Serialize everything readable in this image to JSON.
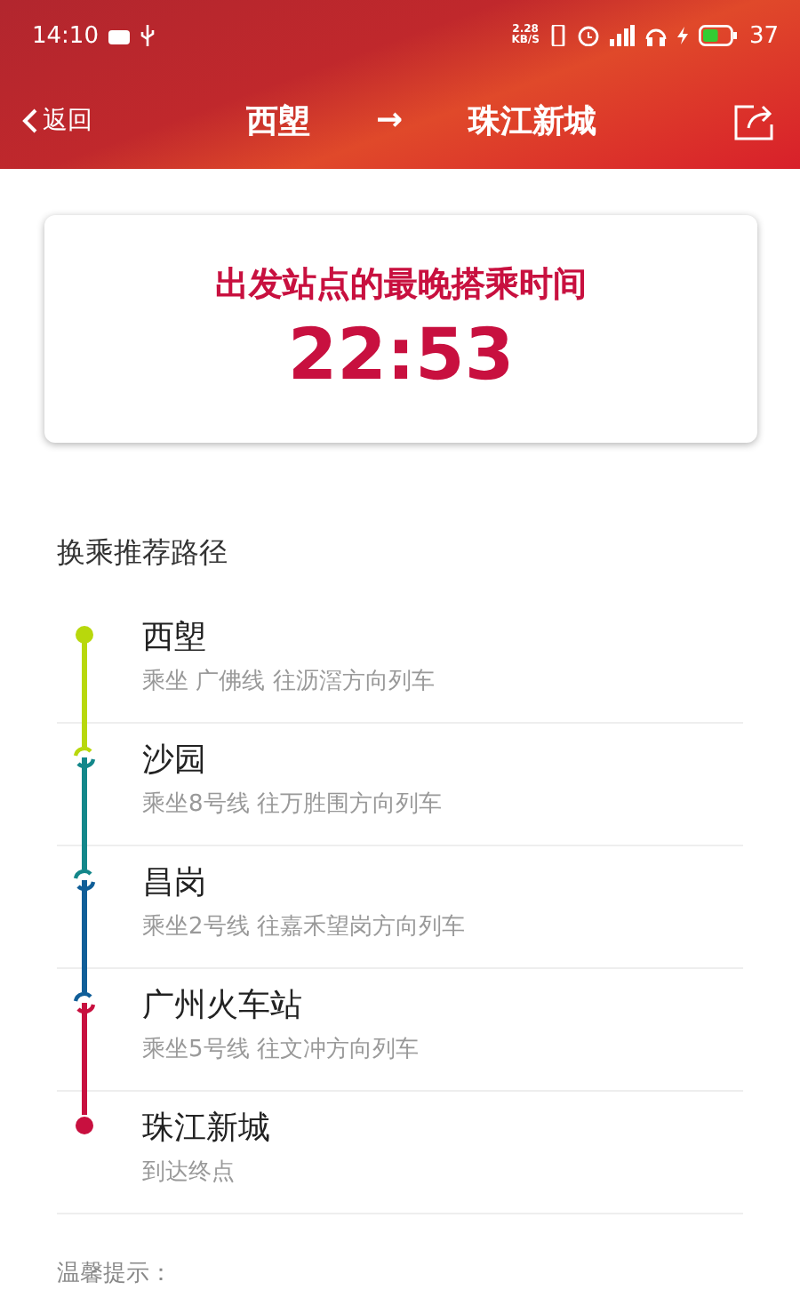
{
  "status_bar": {
    "time": "14:10",
    "speed": "2.28\nKB/S",
    "battery": "37"
  },
  "header": {
    "back": "返回",
    "from": "西塱",
    "arrow": "→",
    "to": "珠江新城"
  },
  "card": {
    "title": "出发站点的最晚搭乘时间",
    "time": "22:53"
  },
  "route_title": "换乘推荐路径",
  "stops": [
    {
      "kind": "start",
      "name": "西塱",
      "detail": "乘坐 广佛线 往沥滘方向列车",
      "color": "#b8d80c"
    },
    {
      "kind": "transfer",
      "name": "沙园",
      "detail": "乘坐8号线 往万胜围方向列车",
      "color": "#13878a"
    },
    {
      "kind": "transfer",
      "name": "昌岗",
      "detail": "乘坐2号线 往嘉禾望岗方向列车",
      "color": "#105e98"
    },
    {
      "kind": "transfer",
      "name": "广州火车站",
      "detail": "乘坐5号线 往文冲方向列车",
      "color": "#c8103f"
    },
    {
      "kind": "end",
      "name": "珠江新城",
      "detail": "到达终点",
      "color": "#c8103f"
    }
  ],
  "tip_title": "温馨提示："
}
